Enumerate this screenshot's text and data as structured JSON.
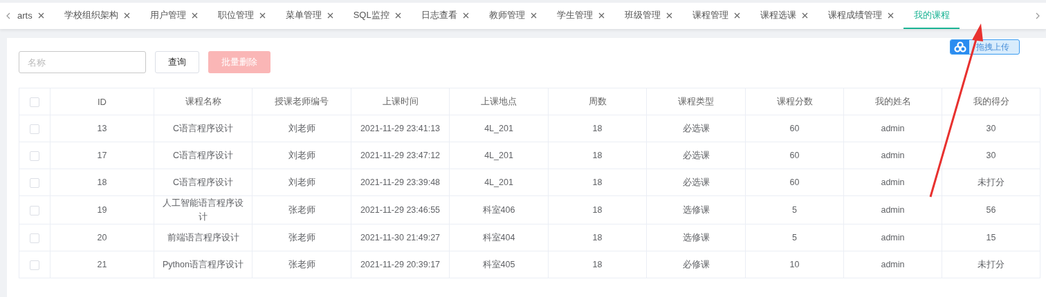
{
  "tabs": [
    {
      "label": "arts",
      "selected": false,
      "closable": true
    },
    {
      "label": "学校组织架构",
      "selected": false,
      "closable": true
    },
    {
      "label": "用户管理",
      "selected": false,
      "closable": true
    },
    {
      "label": "职位管理",
      "selected": false,
      "closable": true
    },
    {
      "label": "菜单管理",
      "selected": false,
      "closable": true
    },
    {
      "label": "SQL监控",
      "selected": false,
      "closable": true
    },
    {
      "label": "日志查看",
      "selected": false,
      "closable": true
    },
    {
      "label": "教师管理",
      "selected": false,
      "closable": true
    },
    {
      "label": "学生管理",
      "selected": false,
      "closable": true
    },
    {
      "label": "班级管理",
      "selected": false,
      "closable": true
    },
    {
      "label": "课程管理",
      "selected": false,
      "closable": true
    },
    {
      "label": "课程选课",
      "selected": false,
      "closable": true
    },
    {
      "label": "课程成绩管理",
      "selected": false,
      "closable": true
    },
    {
      "label": "我的课程",
      "selected": true,
      "closable": false
    }
  ],
  "toolbar": {
    "search": {
      "placeholder": "名称"
    },
    "query_button": "查询",
    "batch_delete_button": {
      "label": "批量删除",
      "disabled": true
    },
    "upload_button": "拖拽上传"
  },
  "table": {
    "select_all": {
      "checked": false
    },
    "columns": [
      "ID",
      "课程名称",
      "授课老师编号",
      "上课时间",
      "上课地点",
      "周数",
      "课程类型",
      "课程分数",
      "我的姓名",
      "我的得分"
    ],
    "rows": [
      {
        "checked": false,
        "cells": [
          "13",
          "C语言程序设计",
          "刘老师",
          "2021-11-29 23:41:13",
          "4L_201",
          "18",
          "必选课",
          "60",
          "admin",
          "30"
        ]
      },
      {
        "checked": false,
        "cells": [
          "17",
          "C语言程序设计",
          "刘老师",
          "2021-11-29 23:47:12",
          "4L_201",
          "18",
          "必选课",
          "60",
          "admin",
          "30"
        ]
      },
      {
        "checked": false,
        "cells": [
          "18",
          "C语言程序设计",
          "刘老师",
          "2021-11-29 23:39:48",
          "4L_201",
          "18",
          "必选课",
          "60",
          "admin",
          "未打分"
        ]
      },
      {
        "checked": false,
        "cells": [
          "19",
          "人工智能语言程序设计",
          "张老师",
          "2021-11-29 23:46:55",
          "科室406",
          "18",
          "选修课",
          "5",
          "admin",
          "56"
        ]
      },
      {
        "checked": false,
        "cells": [
          "20",
          "前端语言程序设计",
          "张老师",
          "2021-11-30 21:49:27",
          "科室404",
          "18",
          "选修课",
          "5",
          "admin",
          "15"
        ]
      },
      {
        "checked": false,
        "cells": [
          "21",
          "Python语言程序设计",
          "张老师",
          "2021-11-29 20:39:17",
          "科室405",
          "18",
          "必修课",
          "10",
          "admin",
          "未打分"
        ]
      }
    ]
  }
}
